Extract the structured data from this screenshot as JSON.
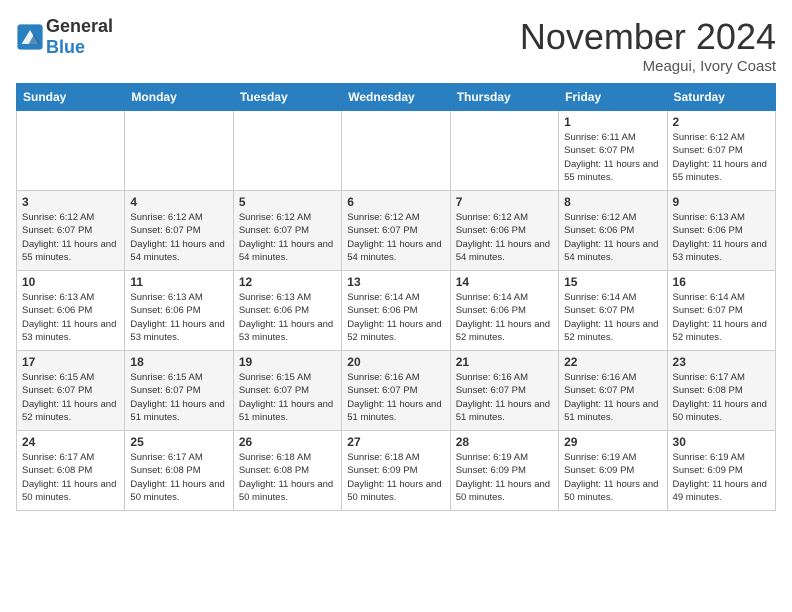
{
  "header": {
    "logo_general": "General",
    "logo_blue": "Blue",
    "month_title": "November 2024",
    "location": "Meagui, Ivory Coast"
  },
  "calendar": {
    "weekdays": [
      "Sunday",
      "Monday",
      "Tuesday",
      "Wednesday",
      "Thursday",
      "Friday",
      "Saturday"
    ],
    "weeks": [
      [
        {
          "day": "",
          "info": ""
        },
        {
          "day": "",
          "info": ""
        },
        {
          "day": "",
          "info": ""
        },
        {
          "day": "",
          "info": ""
        },
        {
          "day": "",
          "info": ""
        },
        {
          "day": "1",
          "info": "Sunrise: 6:11 AM\nSunset: 6:07 PM\nDaylight: 11 hours and 55 minutes."
        },
        {
          "day": "2",
          "info": "Sunrise: 6:12 AM\nSunset: 6:07 PM\nDaylight: 11 hours and 55 minutes."
        }
      ],
      [
        {
          "day": "3",
          "info": "Sunrise: 6:12 AM\nSunset: 6:07 PM\nDaylight: 11 hours and 55 minutes."
        },
        {
          "day": "4",
          "info": "Sunrise: 6:12 AM\nSunset: 6:07 PM\nDaylight: 11 hours and 54 minutes."
        },
        {
          "day": "5",
          "info": "Sunrise: 6:12 AM\nSunset: 6:07 PM\nDaylight: 11 hours and 54 minutes."
        },
        {
          "day": "6",
          "info": "Sunrise: 6:12 AM\nSunset: 6:07 PM\nDaylight: 11 hours and 54 minutes."
        },
        {
          "day": "7",
          "info": "Sunrise: 6:12 AM\nSunset: 6:06 PM\nDaylight: 11 hours and 54 minutes."
        },
        {
          "day": "8",
          "info": "Sunrise: 6:12 AM\nSunset: 6:06 PM\nDaylight: 11 hours and 54 minutes."
        },
        {
          "day": "9",
          "info": "Sunrise: 6:13 AM\nSunset: 6:06 PM\nDaylight: 11 hours and 53 minutes."
        }
      ],
      [
        {
          "day": "10",
          "info": "Sunrise: 6:13 AM\nSunset: 6:06 PM\nDaylight: 11 hours and 53 minutes."
        },
        {
          "day": "11",
          "info": "Sunrise: 6:13 AM\nSunset: 6:06 PM\nDaylight: 11 hours and 53 minutes."
        },
        {
          "day": "12",
          "info": "Sunrise: 6:13 AM\nSunset: 6:06 PM\nDaylight: 11 hours and 53 minutes."
        },
        {
          "day": "13",
          "info": "Sunrise: 6:14 AM\nSunset: 6:06 PM\nDaylight: 11 hours and 52 minutes."
        },
        {
          "day": "14",
          "info": "Sunrise: 6:14 AM\nSunset: 6:06 PM\nDaylight: 11 hours and 52 minutes."
        },
        {
          "day": "15",
          "info": "Sunrise: 6:14 AM\nSunset: 6:07 PM\nDaylight: 11 hours and 52 minutes."
        },
        {
          "day": "16",
          "info": "Sunrise: 6:14 AM\nSunset: 6:07 PM\nDaylight: 11 hours and 52 minutes."
        }
      ],
      [
        {
          "day": "17",
          "info": "Sunrise: 6:15 AM\nSunset: 6:07 PM\nDaylight: 11 hours and 52 minutes."
        },
        {
          "day": "18",
          "info": "Sunrise: 6:15 AM\nSunset: 6:07 PM\nDaylight: 11 hours and 51 minutes."
        },
        {
          "day": "19",
          "info": "Sunrise: 6:15 AM\nSunset: 6:07 PM\nDaylight: 11 hours and 51 minutes."
        },
        {
          "day": "20",
          "info": "Sunrise: 6:16 AM\nSunset: 6:07 PM\nDaylight: 11 hours and 51 minutes."
        },
        {
          "day": "21",
          "info": "Sunrise: 6:16 AM\nSunset: 6:07 PM\nDaylight: 11 hours and 51 minutes."
        },
        {
          "day": "22",
          "info": "Sunrise: 6:16 AM\nSunset: 6:07 PM\nDaylight: 11 hours and 51 minutes."
        },
        {
          "day": "23",
          "info": "Sunrise: 6:17 AM\nSunset: 6:08 PM\nDaylight: 11 hours and 50 minutes."
        }
      ],
      [
        {
          "day": "24",
          "info": "Sunrise: 6:17 AM\nSunset: 6:08 PM\nDaylight: 11 hours and 50 minutes."
        },
        {
          "day": "25",
          "info": "Sunrise: 6:17 AM\nSunset: 6:08 PM\nDaylight: 11 hours and 50 minutes."
        },
        {
          "day": "26",
          "info": "Sunrise: 6:18 AM\nSunset: 6:08 PM\nDaylight: 11 hours and 50 minutes."
        },
        {
          "day": "27",
          "info": "Sunrise: 6:18 AM\nSunset: 6:09 PM\nDaylight: 11 hours and 50 minutes."
        },
        {
          "day": "28",
          "info": "Sunrise: 6:19 AM\nSunset: 6:09 PM\nDaylight: 11 hours and 50 minutes."
        },
        {
          "day": "29",
          "info": "Sunrise: 6:19 AM\nSunset: 6:09 PM\nDaylight: 11 hours and 50 minutes."
        },
        {
          "day": "30",
          "info": "Sunrise: 6:19 AM\nSunset: 6:09 PM\nDaylight: 11 hours and 49 minutes."
        }
      ]
    ]
  }
}
